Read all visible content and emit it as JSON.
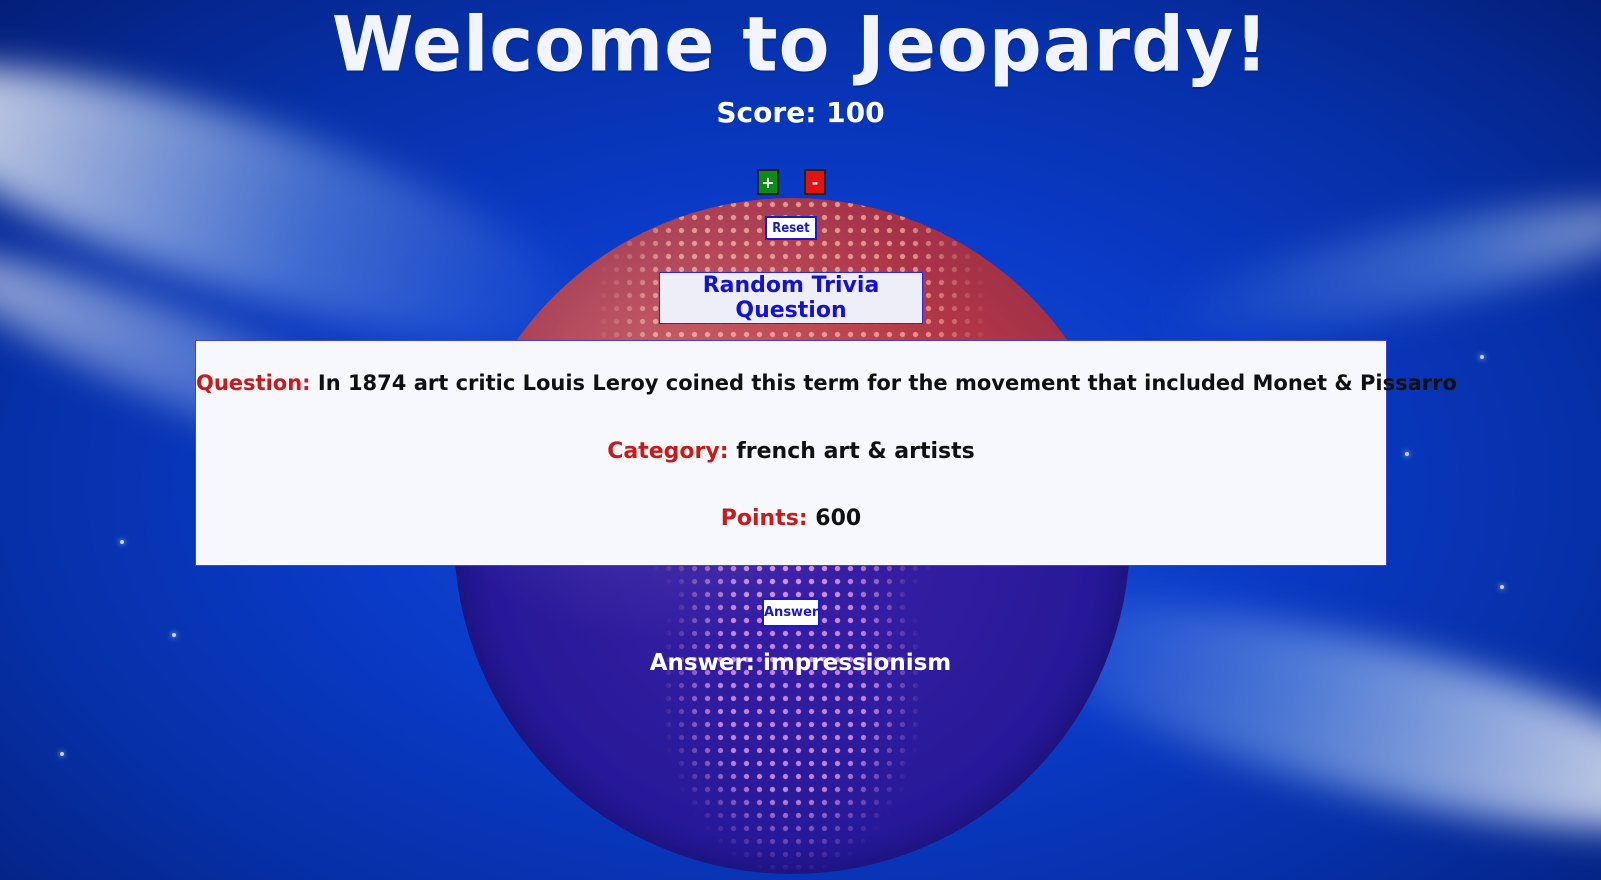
{
  "header": {
    "title": "Welcome to Jeopardy!",
    "score_text": "Score: 100"
  },
  "controls": {
    "plus_label": "+",
    "minus_label": "-",
    "reset_label": "Reset",
    "random_label": "Random Trivia Question",
    "answer_label": "Answer"
  },
  "question": {
    "question_label": "Question:",
    "question_text": "In 1874 art critic Louis Leroy coined this term for the movement that included Monet & Pissarro",
    "category_label": "Category:",
    "category_text": "french art & artists",
    "points_label": "Points:",
    "points_value": "600"
  },
  "answer": {
    "text": "Answer: impressionism"
  },
  "colors": {
    "background": "#0a3bc8",
    "plus_button": "#0e8a16",
    "minus_button": "#e01212",
    "button_text": "#1a1ac8",
    "label_red": "#c81a1a"
  }
}
